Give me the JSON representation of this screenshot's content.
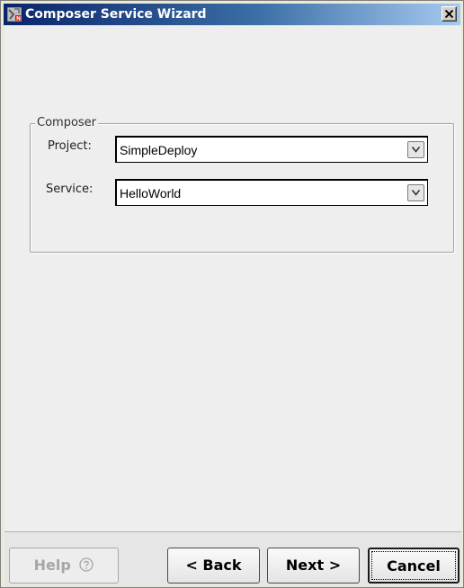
{
  "window": {
    "title": "Composer Service Wizard",
    "close_symbol": "X"
  },
  "icons": {
    "app": "wizard-app-icon",
    "close": "close-x-icon",
    "dropdown": "chevron-down-icon",
    "help": "question-circle-icon"
  },
  "group": {
    "legend": "Composer",
    "fields": [
      {
        "label": "Project:",
        "value": "SimpleDeploy"
      },
      {
        "label": "Service:",
        "value": "HelloWorld"
      }
    ]
  },
  "buttons": {
    "help": "Help",
    "back": "< Back",
    "next": "Next >",
    "cancel": "Cancel"
  },
  "colors": {
    "titlebar_start": "#0a246a",
    "titlebar_end": "#a6caf0",
    "panel_bg": "#eeeeee",
    "disabled_text": "#a6a6a6"
  }
}
